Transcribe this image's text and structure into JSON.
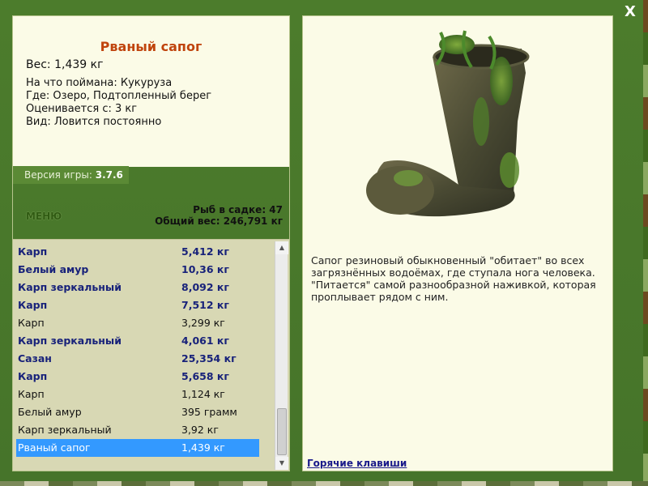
{
  "window": {
    "close_label": "X"
  },
  "info": {
    "title": "Рваный сапог",
    "weight": "Вес: 1,439 кг",
    "caught_on": "На что поймана: Кукуруза",
    "location": "Где: Озеро, Подтопленный берег",
    "valued_from": "Оценивается с: 3 кг",
    "type": "Вид: Ловится постоянно"
  },
  "version": {
    "label": "Версия игры: ",
    "number": "3.7.6"
  },
  "menu": {
    "label": "МЕНЮ"
  },
  "stats": {
    "fish_in_keepnet": "Рыб в садке: 47",
    "total_weight": "Общий вес: 246,791 кг"
  },
  "catch_list": [
    {
      "name": "Карп",
      "weight": "5,412 кг",
      "bold": true
    },
    {
      "name": "Белый амур",
      "weight": "10,36 кг",
      "bold": true
    },
    {
      "name": "Карп зеркальный",
      "weight": "8,092 кг",
      "bold": true
    },
    {
      "name": "Карп",
      "weight": "7,512 кг",
      "bold": true
    },
    {
      "name": "Карп",
      "weight": "3,299 кг",
      "bold": false
    },
    {
      "name": "Карп зеркальный",
      "weight": "4,061 кг",
      "bold": true
    },
    {
      "name": "Сазан",
      "weight": "25,354 кг",
      "bold": true
    },
    {
      "name": "Карп",
      "weight": "5,658 кг",
      "bold": true
    },
    {
      "name": "Карп",
      "weight": "1,124 кг",
      "bold": false
    },
    {
      "name": "Белый амур",
      "weight": "395 грамм",
      "bold": false
    },
    {
      "name": "Карп зеркальный",
      "weight": "3,92 кг",
      "bold": false
    },
    {
      "name": "Рваный сапог",
      "weight": "1,439 кг",
      "bold": false,
      "selected": true
    }
  ],
  "scrollbar": {
    "up_glyph": "▲",
    "down_glyph": "▼"
  },
  "description": "Сапог резиновый обыкновенный \"обитает\" во всех загрязнённых водоёмах, где ступала нога человека. \"Питается\" самой разнообразной наживкой, которая проплывает рядом с ним.",
  "hotkeys": {
    "label": "Горячие клавиши"
  },
  "colors": {
    "title": "#c0440d",
    "bold_row": "#18227a",
    "selected_row": "#3399ff",
    "panel_bg": "#fbfbe7",
    "list_bg": "#d8d8b4",
    "frame": "#4a7a2a"
  },
  "icons": {
    "close": "close-icon",
    "image": "torn-boot-image"
  }
}
